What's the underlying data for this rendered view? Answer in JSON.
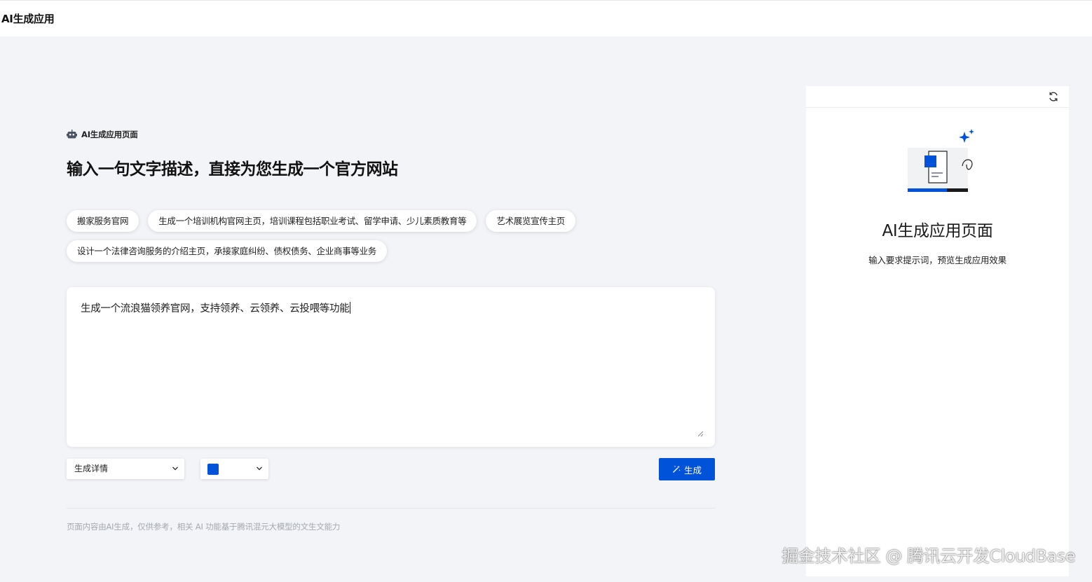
{
  "app": {
    "title": "AI生成应用"
  },
  "main": {
    "section_tag": "AI生成应用页面",
    "headline": "输入一句文字描述，直接为您生成一个官方网站",
    "suggestions": [
      "搬家服务官网",
      "生成一个培训机构官网主页，培训课程包括职业考试、留学申请、少儿素质教育等",
      "艺术展览宣传主页",
      "设计一个法律咨询服务的介绍主页，承接家庭纠纷、债权债务、企业商事等业务"
    ],
    "prompt": {
      "value": "生成一个流浪猫领养官网，支持领养、云领养、云投喂等功能"
    },
    "controls": {
      "detail_select_value": "生成详情",
      "color_select_value": "#0052d9",
      "generate_label": "生成"
    },
    "disclaimer": "页面内容由AI生成，仅供参考，相关 AI 功能基于腾讯混元大模型的文生文能力"
  },
  "preview": {
    "title": "AI生成应用页面",
    "description": "输入要求提示词，预览生成应用效果"
  },
  "watermark": "掘金技术社区 @ 腾讯云开发CloudBase",
  "colors": {
    "accent": "#0052d9",
    "background": "#f3f4f7"
  },
  "icons": {
    "robot": "robot-icon",
    "refresh": "refresh-icon",
    "wand": "magic-wand-icon",
    "chevron": "chevron-down-icon"
  }
}
